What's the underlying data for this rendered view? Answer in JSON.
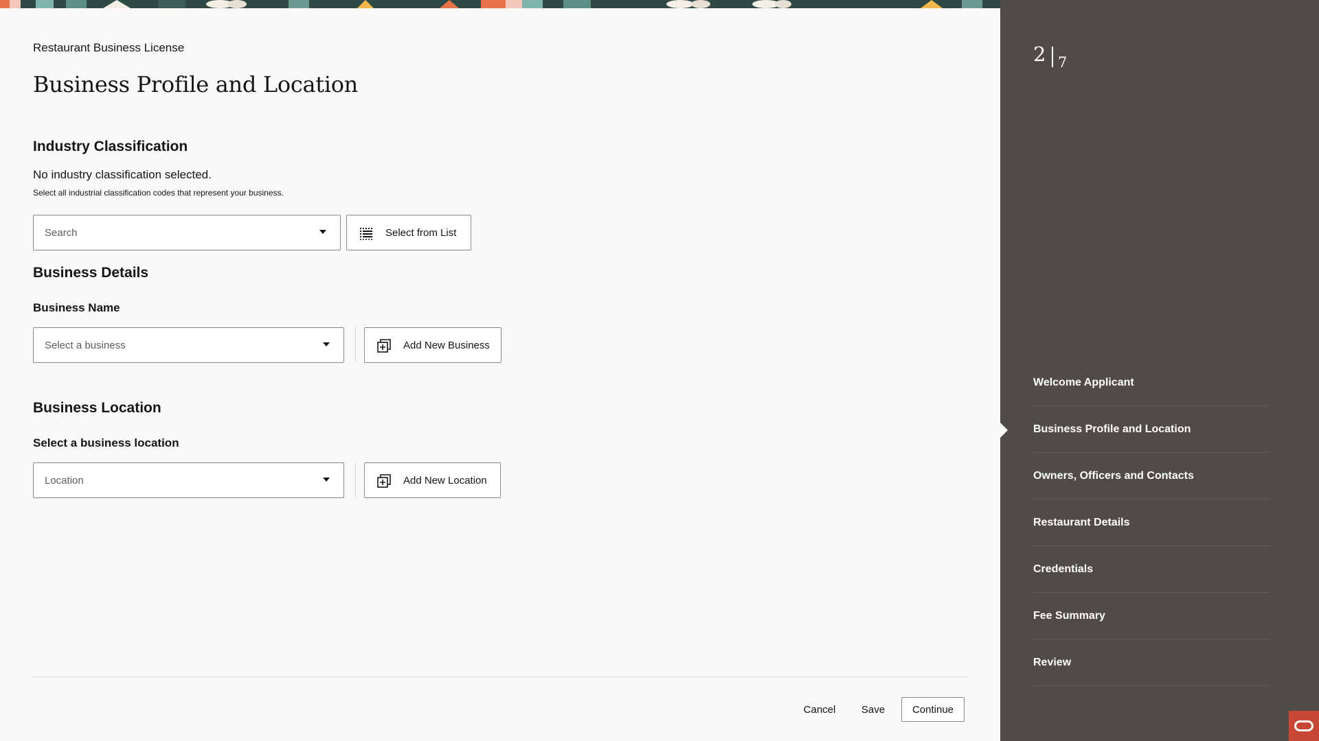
{
  "header": {
    "app_title": "Restaurant Business License",
    "page_title": "Business Profile and Location"
  },
  "industry": {
    "heading": "Industry Classification",
    "status": "No industry classification selected.",
    "helper": "Select all industrial classification codes that represent your business.",
    "search_placeholder": "Search",
    "select_list_button": "Select from List"
  },
  "business_details": {
    "heading": "Business Details",
    "name_label": "Business Name",
    "select_placeholder": "Select a business",
    "add_button": "Add New Business"
  },
  "business_location": {
    "heading": "Business Location",
    "label": "Select a business location",
    "select_placeholder": "Location",
    "add_button": "Add New Location"
  },
  "footer": {
    "cancel": "Cancel",
    "save": "Save",
    "continue": "Continue"
  },
  "progress": {
    "current": "2",
    "total": "7"
  },
  "steps": [
    {
      "label": "Welcome Applicant"
    },
    {
      "label": "Business Profile and Location"
    },
    {
      "label": "Owners, Officers and Contacts"
    },
    {
      "label": "Restaurant Details"
    },
    {
      "label": "Credentials"
    },
    {
      "label": "Fee Summary"
    },
    {
      "label": "Review"
    }
  ],
  "colors": {
    "sidebar_bg": "#4f4b47",
    "page_bg": "#faf9f7",
    "brand_red": "#c74634"
  },
  "icons": {
    "select_list": "list-grid-icon",
    "add_new": "add-box-icon",
    "dropdown": "chevron-down-icon",
    "brand": "oracle-logo-icon"
  }
}
